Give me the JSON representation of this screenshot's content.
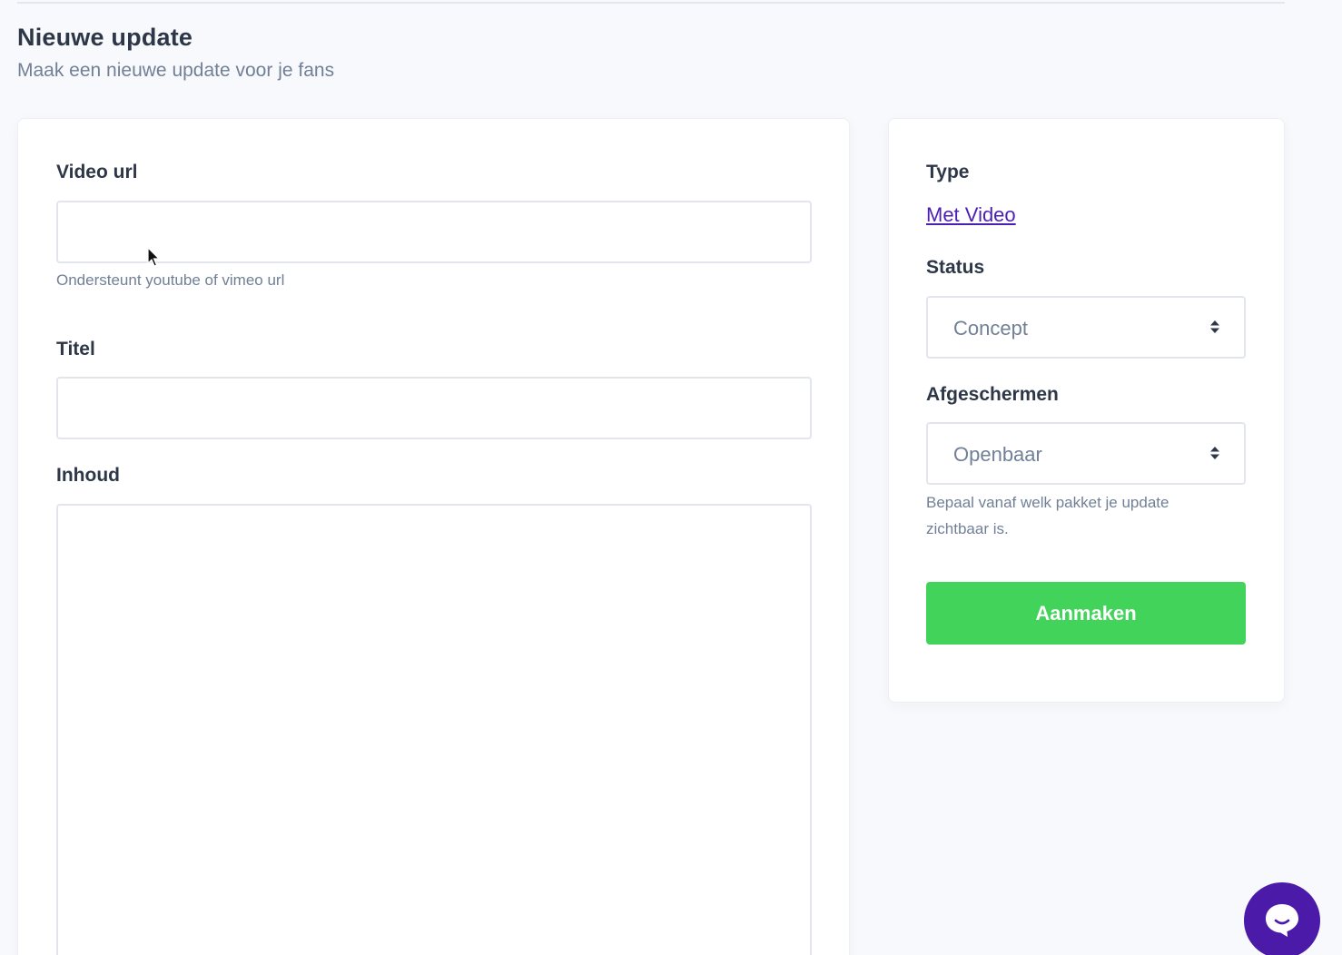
{
  "header": {
    "title": "Nieuwe update",
    "subtitle": "Maak een nieuwe update voor je fans"
  },
  "form": {
    "video_url": {
      "label": "Video url",
      "value": "",
      "placeholder": "",
      "help": "Ondersteunt youtube of vimeo url"
    },
    "title": {
      "label": "Titel",
      "value": "",
      "placeholder": ""
    },
    "content": {
      "label": "Inhoud",
      "value": "",
      "placeholder": ""
    }
  },
  "sidebar": {
    "type": {
      "label": "Type",
      "link": "Met Video"
    },
    "status": {
      "label": "Status",
      "selected": "Concept"
    },
    "visibility": {
      "label": "Afgeschermen",
      "selected": "Openbaar",
      "help": "Bepaal vanaf welk pakket je update zichtbaar is."
    },
    "submit_label": "Aanmaken"
  },
  "icons": {
    "select_arrows": "sort-arrows-icon",
    "chat": "chat-bubble-icon",
    "cursor": "mouse-cursor-icon"
  },
  "colors": {
    "accent_green": "#42d35a",
    "link_purple": "#4c1fb4",
    "chat_purple": "#4b1aa8",
    "background": "#f8f9fc"
  }
}
